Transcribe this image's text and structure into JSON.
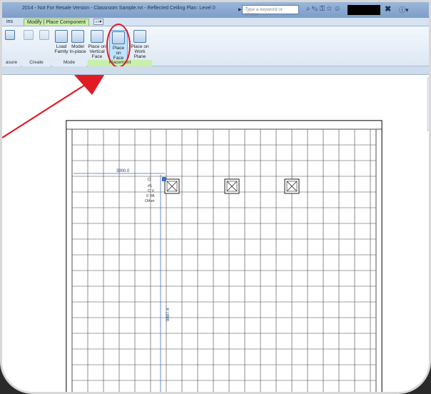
{
  "titlebar": {
    "title": "2014 - Not For Resale Version -  Classroom Sample.rvt - Reflected Ceiling Plan: Level 0",
    "search_placeholder": "Type a keyword or phrase"
  },
  "tabs": [
    {
      "label": "ins"
    },
    {
      "label": "Modify | Place Component"
    }
  ],
  "ribbon": {
    "buttons": [
      {
        "label_1": "Load",
        "label_2": "Family"
      },
      {
        "label_1": "Model",
        "label_2": "In-place"
      },
      {
        "label_1": "Place on",
        "label_2": "Vertical Face"
      },
      {
        "label_1": "Place on",
        "label_2": "Face"
      },
      {
        "label_1": "Place on",
        "label_2": "Work Plane"
      }
    ],
    "panels": [
      {
        "label": "asure"
      },
      {
        "label": "Create"
      },
      {
        "label": "Mode"
      },
      {
        "label": "Placement"
      }
    ]
  },
  "canvas": {
    "dimension_horizontal": "3900.0",
    "dimension_vertical": "9897.4",
    "tag_line_1": "#1",
    "tag_line_2": "C V",
    "tag_line_3": "0 VA",
    "tag_line_4": "Other"
  },
  "colors": {
    "annotation_red": "#d91a2a",
    "active_tab": "#c9efa9",
    "dimension_blue": "#3a6fc4"
  }
}
